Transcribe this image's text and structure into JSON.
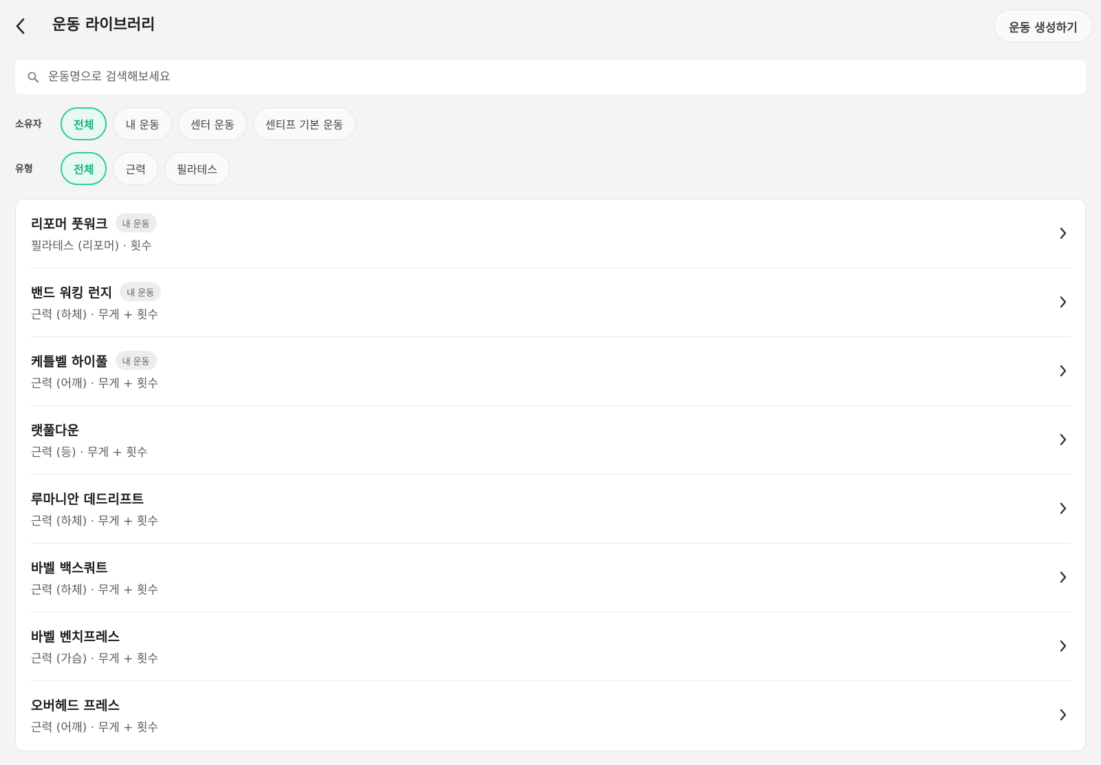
{
  "header": {
    "title": "운동 라이브러리",
    "create_label": "운동 생성하기"
  },
  "search": {
    "placeholder": "운동명으로 검색해보세요",
    "value": ""
  },
  "filters": {
    "owner": {
      "label": "소유자",
      "options": [
        "전체",
        "내 운동",
        "센터 운동",
        "센티프 기본 운동"
      ],
      "selected": "전체"
    },
    "type": {
      "label": "유형",
      "options": [
        "전체",
        "근력",
        "필라테스"
      ],
      "selected": "전체"
    }
  },
  "exercises": [
    {
      "name": "리포머 풋워크",
      "badge": "내 운동",
      "sub": "필라테스 (리포머) · 횟수"
    },
    {
      "name": "밴드 워킹 런지",
      "badge": "내 운동",
      "sub": "근력 (하체) · 무게 + 횟수"
    },
    {
      "name": "케틀벨 하이풀",
      "badge": "내 운동",
      "sub": "근력 (어깨) · 무게 + 횟수"
    },
    {
      "name": "랫풀다운",
      "badge": "",
      "sub": "근력 (등) · 무게 + 횟수"
    },
    {
      "name": "루마니안 데드리프트",
      "badge": "",
      "sub": "근력 (하체) · 무게 + 횟수"
    },
    {
      "name": "바벨 백스쿼트",
      "badge": "",
      "sub": "근력 (하체) · 무게 + 횟수"
    },
    {
      "name": "바벨 벤치프레스",
      "badge": "",
      "sub": "근력 (가슴) · 무게 + 횟수"
    },
    {
      "name": "오버헤드 프레스",
      "badge": "",
      "sub": "근력 (어깨) · 무게 + 횟수"
    }
  ],
  "colors": {
    "accent": "#2fcc9c",
    "accent_bg": "#e8f8f2",
    "background": "#f4f4f4"
  },
  "icons": {
    "back": "chevron-left-icon",
    "search": "search-icon",
    "row": "chevron-right-icon"
  }
}
